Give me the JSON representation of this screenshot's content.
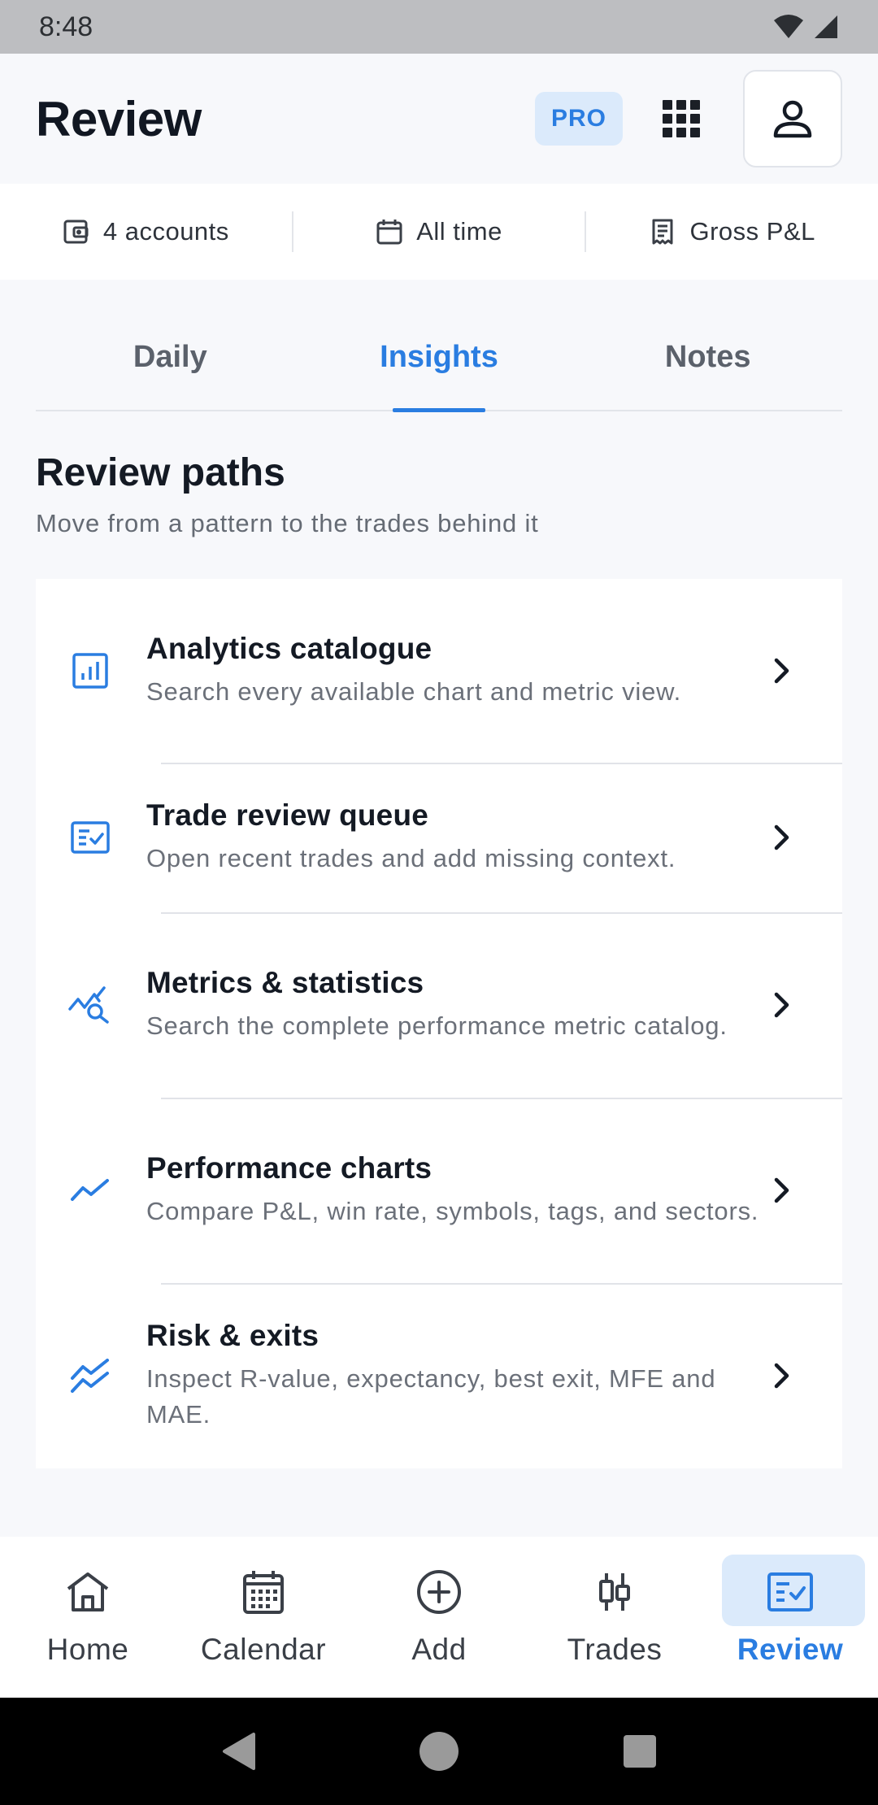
{
  "status_bar": {
    "time": "8:48"
  },
  "header": {
    "title": "Review",
    "pro_badge": "PRO"
  },
  "filters": [
    {
      "icon": "wallet-icon",
      "label": "4 accounts"
    },
    {
      "icon": "calendar-icon",
      "label": "All time"
    },
    {
      "icon": "receipt-icon",
      "label": "Gross P&L"
    }
  ],
  "tabs": [
    {
      "label": "Daily",
      "active": false
    },
    {
      "label": "Insights",
      "active": true
    },
    {
      "label": "Notes",
      "active": false
    }
  ],
  "section": {
    "title": "Review paths",
    "subtitle": "Move from a pattern to the trades behind it"
  },
  "paths": [
    {
      "icon": "bar-chart-icon",
      "title": "Analytics catalogue",
      "description": "Search every available chart and metric view."
    },
    {
      "icon": "checklist-icon",
      "title": "Trade review queue",
      "description": "Open recent trades and add missing context."
    },
    {
      "icon": "chart-search-icon",
      "title": "Metrics & statistics",
      "description": "Search the complete performance metric catalog."
    },
    {
      "icon": "trend-line-icon",
      "title": "Performance charts",
      "description": "Compare P&L, win rate, symbols, tags, and sectors."
    },
    {
      "icon": "double-trend-icon",
      "title": "Risk & exits",
      "description": "Inspect R-value, expectancy, best exit, MFE and MAE."
    }
  ],
  "bottom_nav": [
    {
      "icon": "home-icon",
      "label": "Home",
      "active": false
    },
    {
      "icon": "calendar-icon",
      "label": "Calendar",
      "active": false
    },
    {
      "icon": "add-circle-icon",
      "label": "Add",
      "active": false
    },
    {
      "icon": "candlestick-icon",
      "label": "Trades",
      "active": false
    },
    {
      "icon": "review-icon",
      "label": "Review",
      "active": true
    }
  ],
  "colors": {
    "accent": "#2a7de1",
    "accent_bg": "#dbeafb",
    "text": "#141a24",
    "muted": "#6b7079"
  }
}
